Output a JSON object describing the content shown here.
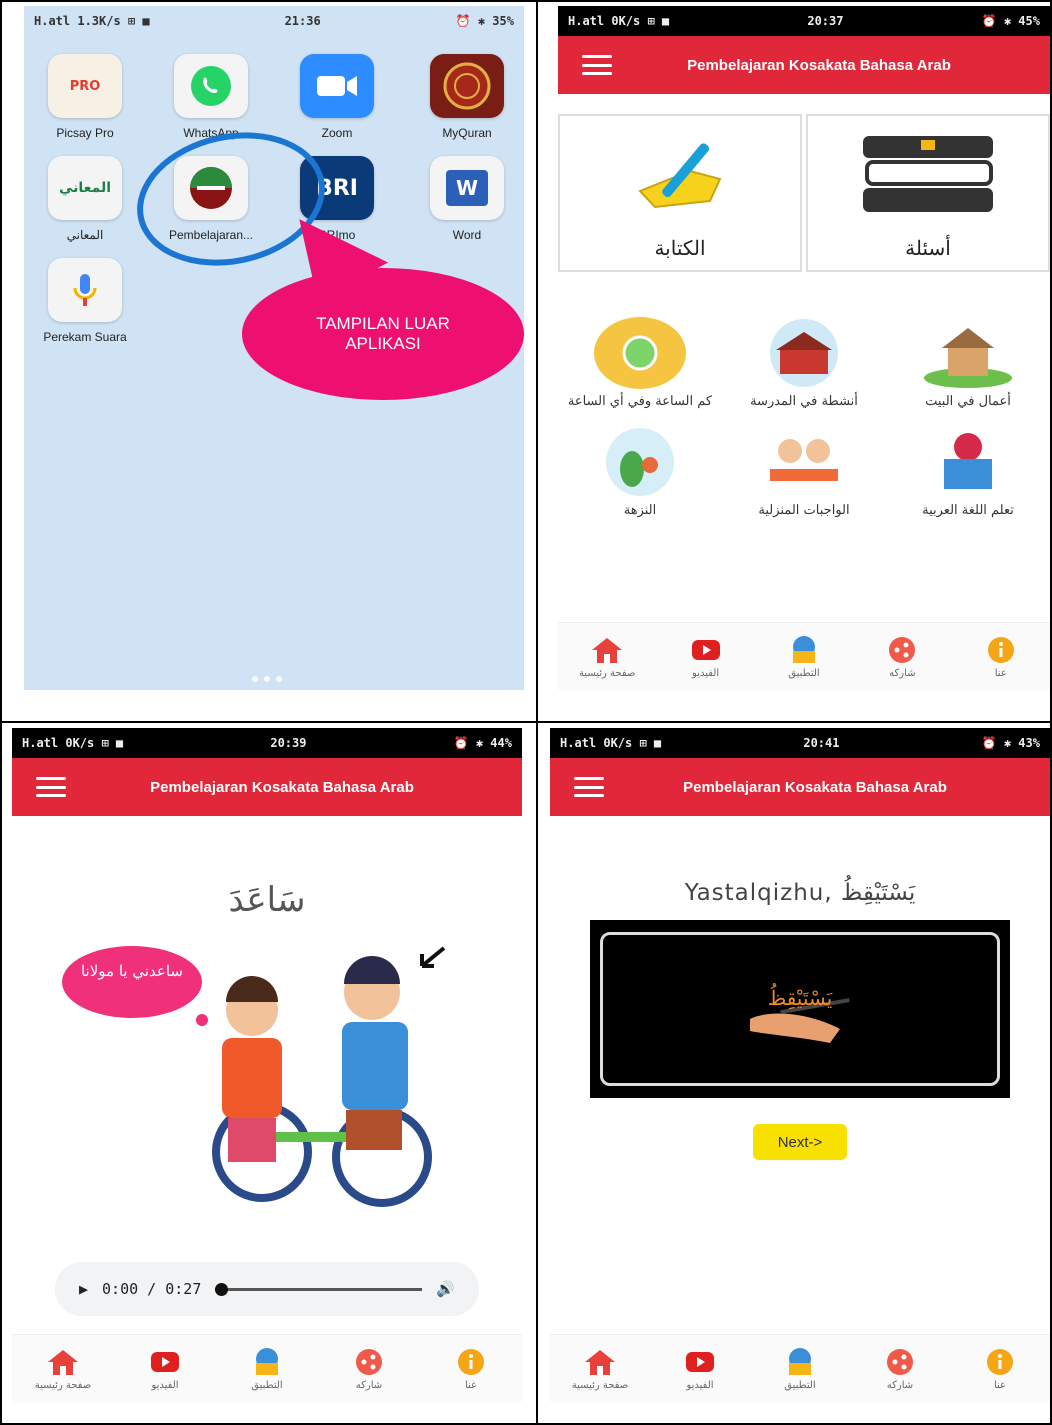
{
  "panel1": {
    "status": {
      "left": "H.atl 1.3K/s ⊞ ■",
      "time": "21:36",
      "right": "⏰ ✱ 35%"
    },
    "apps": [
      {
        "label": "Picsay Pro",
        "icon": "picsay-icon",
        "badge": "PRO",
        "color": "#f6f1e4"
      },
      {
        "label": "WhatsApp",
        "icon": "whatsapp-icon",
        "badge": "",
        "color": "#f4f4f4"
      },
      {
        "label": "Zoom",
        "icon": "zoom-icon",
        "badge": "",
        "color": "#2d8cff"
      },
      {
        "label": "MyQuran",
        "icon": "myquran-icon",
        "badge": "",
        "color": "#7a1d14"
      },
      {
        "label": "المعاني",
        "icon": "almaany-icon",
        "badge": "المعاني",
        "color": "#f4f4f4"
      },
      {
        "label": "Pembelajaran...",
        "icon": "pembelajaran-icon",
        "badge": "",
        "color": "#f4f4f4"
      },
      {
        "label": "BRImo",
        "icon": "brimo-icon",
        "badge": "BRI",
        "color": "#0a3a78"
      },
      {
        "label": "Word",
        "icon": "word-icon",
        "badge": "W",
        "color": "#f4f4f4"
      },
      {
        "label": "Perekam Suara",
        "icon": "voice-recorder-icon",
        "badge": "",
        "color": "#f4f4f4"
      }
    ],
    "callout": {
      "line1": "TAMPILAN LUAR",
      "line2": "APLIKASI"
    }
  },
  "header_title": "Pembelajaran Kosakata Bahasa Arab",
  "panel2": {
    "status": {
      "left": "H.atl 0K/s ⊞ ■",
      "time": "20:37",
      "right": "⏰ ✱ 45%"
    },
    "cards": [
      {
        "label": "الكتابة",
        "icon": "writing-hand-icon"
      },
      {
        "label": "أسئلة",
        "icon": "books-icon"
      }
    ],
    "menu": [
      {
        "label": "كم الساعة وفي أي الساعة",
        "icon": "clock-icon"
      },
      {
        "label": "أنشطة في المدرسة",
        "icon": "school-icon"
      },
      {
        "label": "أعمال في البيت",
        "icon": "house-icon"
      },
      {
        "label": "النزهة",
        "icon": "picnic-icon"
      },
      {
        "label": "الواجبات المنزلية",
        "icon": "homework-icon"
      },
      {
        "label": "تعلم اللغة العربية",
        "icon": "reading-icon"
      }
    ]
  },
  "bottomnav": [
    {
      "label": "صفحة رئيسية",
      "icon": "home-icon",
      "color": "#e8413c"
    },
    {
      "label": "الفيديو",
      "icon": "youtube-icon",
      "color": "#e0201f"
    },
    {
      "label": "التطبيق",
      "icon": "book-globe-icon",
      "color": "#3a8fd8"
    },
    {
      "label": "شاركه",
      "icon": "share-icon",
      "color": "#ef5a4a"
    },
    {
      "label": "عنا",
      "icon": "info-icon",
      "color": "#f5a516"
    }
  ],
  "panel3": {
    "status": {
      "left": "H.atl 0K/s ⊞ ■",
      "time": "20:39",
      "right": "⏰ ✱ 44%"
    },
    "word": "سَاعَدَ",
    "speech": "ساعدني يا مولانا",
    "audio": {
      "time": "0:00 / 0:27",
      "progress": 0
    }
  },
  "panel4": {
    "status": {
      "left": "H.atl 0K/s ⊞ ■",
      "time": "20:41",
      "right": "⏰ ✱ 43%"
    },
    "translation": "Yastalqizhu, يَسْتَيْقِظُ",
    "video_word": "يَسْتَيْقِظُ",
    "next_label": "Next->"
  }
}
